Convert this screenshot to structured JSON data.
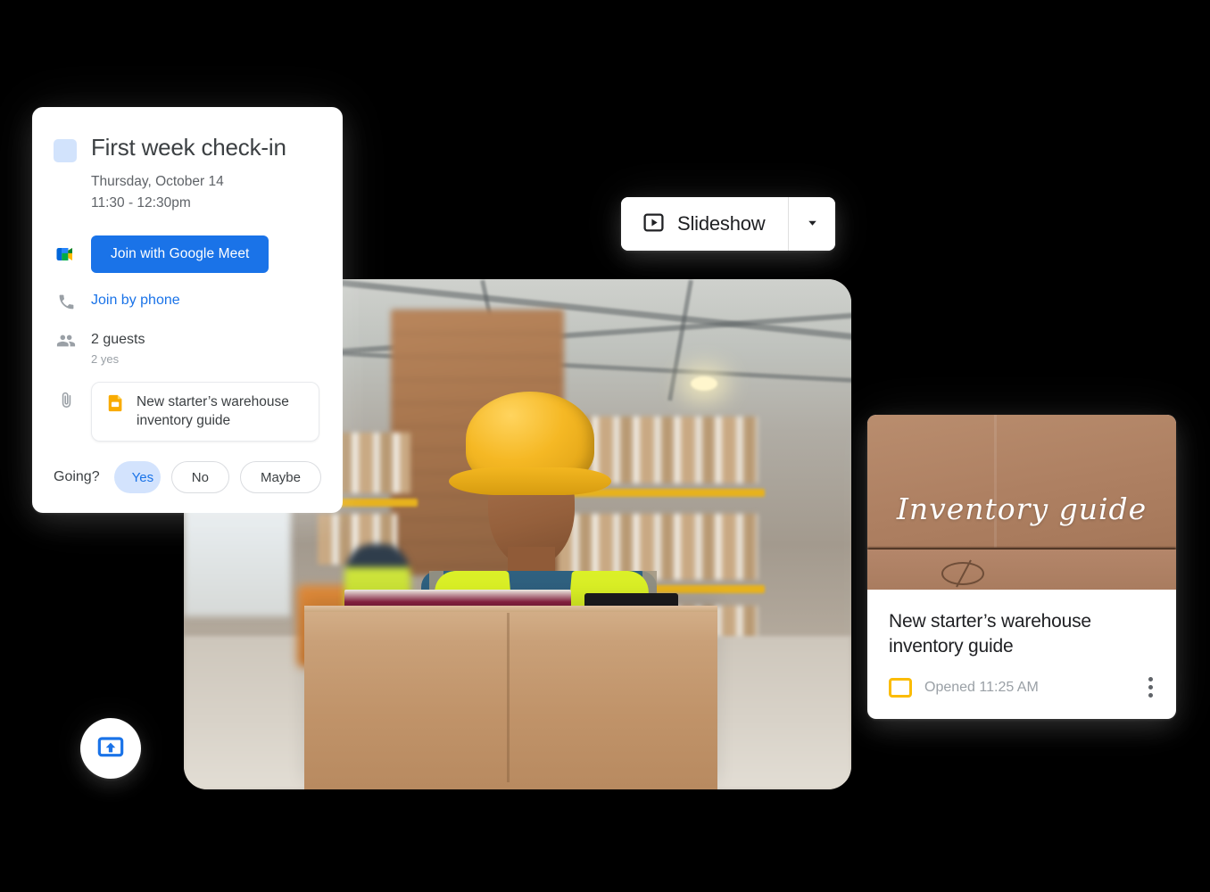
{
  "background_color": "#000000",
  "event_card": {
    "calendar_chip_color": "#d2e3fc",
    "title": "First week check-in",
    "date": "Thursday, October 14",
    "time": "11:30 - 12:30pm",
    "meet_icon_name": "google-meet-icon",
    "join_meet_label": "Join with Google Meet",
    "join_meet_color": "#1a73e8",
    "phone_icon_name": "phone-icon",
    "join_phone_label": "Join by phone",
    "guests_icon_name": "people-icon",
    "guests_count": "2 guests",
    "guests_rsvp": "2 yes",
    "attachment_icon_name": "paperclip-icon",
    "attachment": {
      "file_icon_name": "google-slides-icon",
      "file_icon_color": "#fbbc04",
      "name": "New starter’s warehouse inventory guide"
    },
    "rsvp": {
      "question": "Going?",
      "yes_label": "Yes",
      "yes_selected": true,
      "yes_bg": "#d3e3fd",
      "yes_fg": "#1a73e8",
      "dropdown_icon_name": "chevron-down-icon",
      "no_label": "No",
      "maybe_label": "Maybe"
    }
  },
  "slideshow_button": {
    "play_icon_name": "play-boxed-icon",
    "label": "Slideshow",
    "caret_icon_name": "chevron-down-icon"
  },
  "doc_card": {
    "thumbnail_title": "Inventory guide",
    "thumbnail_alt_name": "cardboard-box-photo",
    "title": "New starter’s warehouse inventory guide",
    "file_icon_name": "google-slides-icon",
    "file_icon_color": "#fbbc04",
    "opened_label": "Opened 11:25 AM",
    "overflow_icon_name": "kebab-menu-icon"
  },
  "photo": {
    "alt_name": "warehouse-worker-photo",
    "description": "Warehouse worker in yellow hard hat and hi-vis vest writing on a clipboard atop a cardboard box"
  },
  "present_button": {
    "icon_name": "present-screen-icon",
    "icon_color": "#1a73e8"
  }
}
